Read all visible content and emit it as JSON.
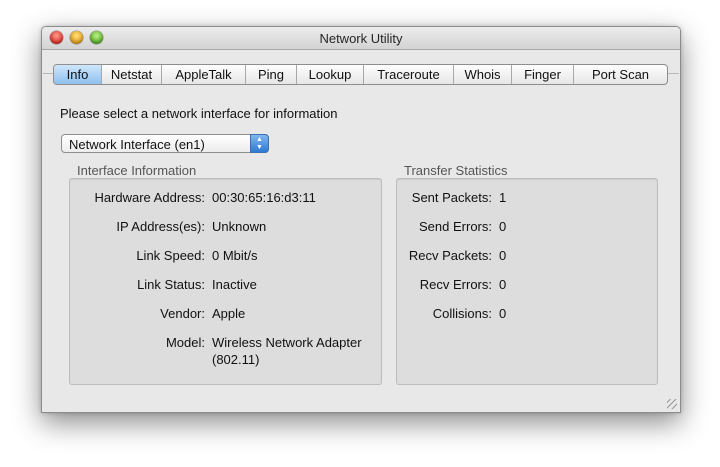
{
  "window": {
    "title": "Network Utility"
  },
  "tabs": [
    {
      "label": "Info",
      "active": true
    },
    {
      "label": "Netstat",
      "active": false
    },
    {
      "label": "AppleTalk",
      "active": false
    },
    {
      "label": "Ping",
      "active": false
    },
    {
      "label": "Lookup",
      "active": false
    },
    {
      "label": "Traceroute",
      "active": false
    },
    {
      "label": "Whois",
      "active": false
    },
    {
      "label": "Finger",
      "active": false
    },
    {
      "label": "Port Scan",
      "active": false
    }
  ],
  "prompt": "Please select a network interface for information",
  "interface_select": {
    "value": "Network Interface (en1)",
    "icon": "up-down-stepper-icon"
  },
  "interface_info": {
    "title": "Interface Information",
    "rows": [
      {
        "label": "Hardware Address:",
        "value": "00:30:65:16:d3:11"
      },
      {
        "label": "IP Address(es):",
        "value": "Unknown"
      },
      {
        "label": "Link Speed:",
        "value": "0 Mbit/s"
      },
      {
        "label": "Link Status:",
        "value": "Inactive"
      },
      {
        "label": "Vendor:",
        "value": "Apple"
      },
      {
        "label": "Model:",
        "value": "Wireless Network Adapter",
        "value2": "(802.11)"
      }
    ]
  },
  "transfer_stats": {
    "title": "Transfer Statistics",
    "rows": [
      {
        "label": "Sent Packets:",
        "value": "1"
      },
      {
        "label": "Send Errors:",
        "value": "0"
      },
      {
        "label": "Recv Packets:",
        "value": "0"
      },
      {
        "label": "Recv Errors:",
        "value": "0"
      },
      {
        "label": "Collisions:",
        "value": "0"
      }
    ]
  },
  "colors": {
    "active_tab": "#8ec0ef",
    "stepper": "#2f78d4",
    "close": "#e1352c",
    "minimize": "#e6a21c",
    "zoom": "#5bb32b"
  }
}
